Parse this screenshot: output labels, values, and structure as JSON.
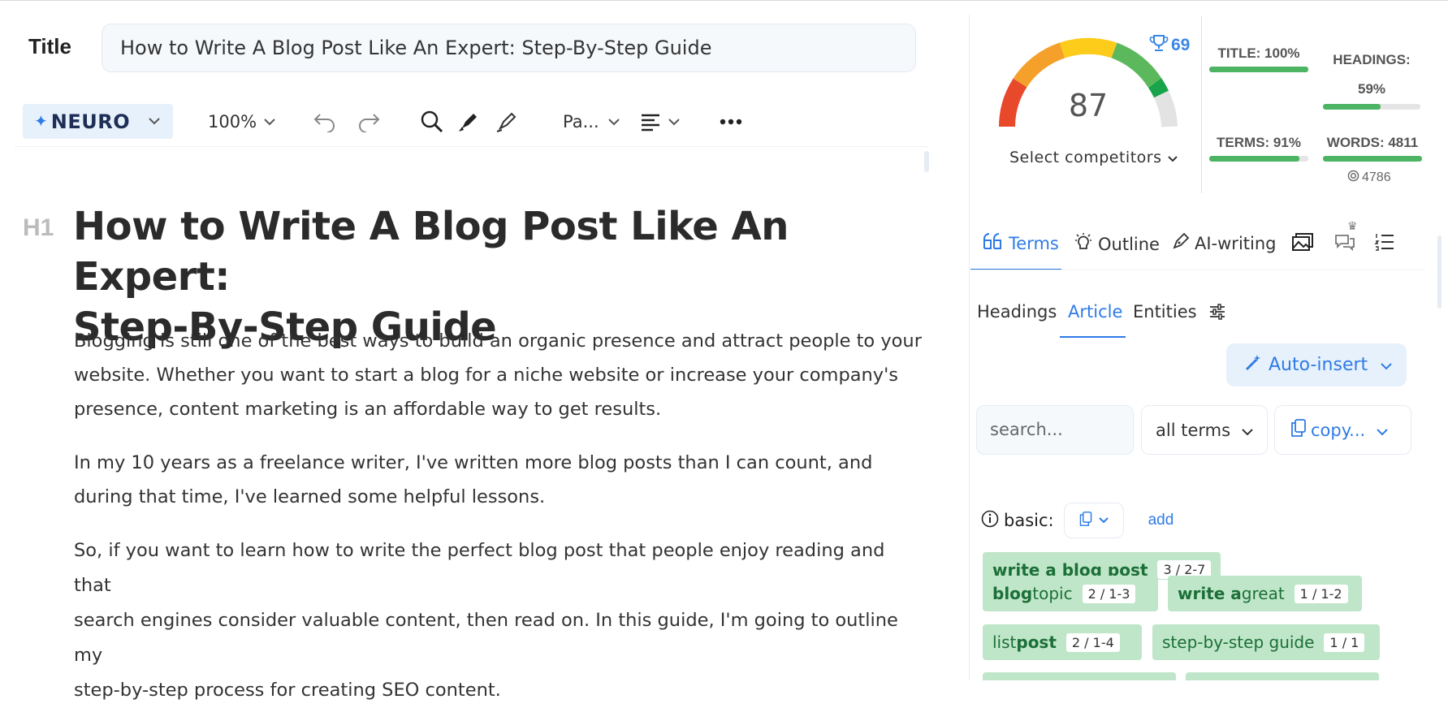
{
  "title_label": "Title",
  "title_value": "How to Write A Blog Post Like An Expert: Step-By-Step Guide",
  "toolbar": {
    "neuro_label": "NEURO",
    "zoom": "100%",
    "paragraph_style": "Pa..."
  },
  "editor": {
    "h1_badge": "H1",
    "heading_line1": "How to Write A Blog Post Like An Expert:",
    "heading_line2": "Step-By-Step Guide",
    "paragraphs": [
      [
        "Blogging is still one of the best ways to build an organic presence and attract people to your",
        "website. Whether you want to start a blog for a niche website or increase your company's",
        "presence, content marketing is an affordable way to get results."
      ],
      [
        "In my 10 years as a freelance writer, I've written more blog posts than I can count, and",
        "during that time, I've learned some helpful lessons."
      ],
      [
        "So, if you want to learn how to write the perfect blog post that people enjoy reading and that",
        "search engines consider valuable content, then read on. In this guide, I'm going to outline my",
        "step-by-step process for creating SEO content."
      ]
    ]
  },
  "scores": {
    "content_score": "87",
    "top_score": "69",
    "select_competitors": "Select competitors",
    "title_metric": "TITLE: 100%",
    "title_fill": 1.0,
    "headings_metric": "HEADINGS:",
    "headings_value": "59%",
    "headings_fill": 0.59,
    "terms_metric": "TERMS: 91%",
    "terms_fill": 0.91,
    "words_metric": "WORDS: 4811",
    "words_fill": 1.0,
    "words_target": "4786"
  },
  "panel_tabs": [
    "Terms",
    "Outline",
    "AI-writing"
  ],
  "sub_tabs": [
    "Headings",
    "Article",
    "Entities"
  ],
  "auto_insert": "Auto-insert",
  "search_placeholder": "search...",
  "filter_value": "all terms",
  "copy_label": "copy...",
  "basic_label": "basic:",
  "add_label": "add",
  "terms": [
    {
      "bold": "write a blog post",
      "rest": "",
      "count": "3 / 2-7"
    },
    {
      "bold": "blog",
      "rest": " topic",
      "count": "2 / 1-3"
    },
    {
      "bold": "write a",
      "rest": " great",
      "count": "1 / 1-2"
    },
    {
      "bold": "",
      "rest": "list ",
      "bold2": "post",
      "count": "2 / 1-4"
    },
    {
      "bold": "",
      "rest": "step-by-step guide",
      "count": "1 / 1"
    }
  ],
  "colors": {
    "accent": "#2f7be5",
    "chip_bg": "#bfe6c9",
    "chip_text": "#1c6f37",
    "bar_fill": "#4cb462"
  }
}
